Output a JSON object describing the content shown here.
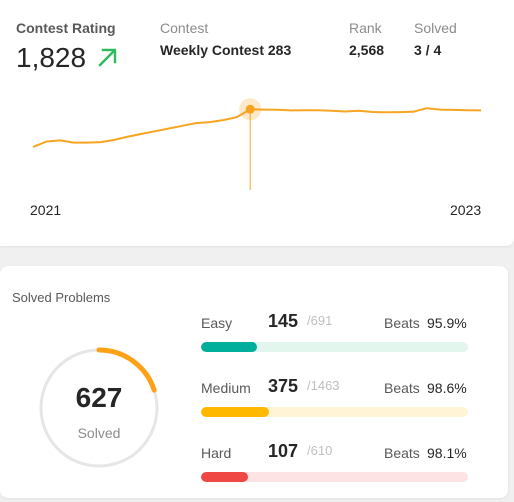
{
  "rating": {
    "title": "Contest Rating",
    "value": "1,828",
    "contest_label": "Contest",
    "contest_name": "Weekly Contest 283",
    "rank_label": "Rank",
    "rank_value": "2,568",
    "solved_label": "Solved",
    "solved_value": "3 / 4",
    "trend_icon": "arrow-up-right-icon",
    "trend_color": "#2cbb5d",
    "line_color": "#f7a521"
  },
  "chart_data": {
    "type": "line",
    "x_tick_labels": [
      "2021",
      "2023"
    ],
    "series": [
      {
        "values": [
          1480,
          1530,
          1540,
          1520,
          1520,
          1525,
          1545,
          1575,
          1600,
          1625,
          1650,
          1675,
          1700,
          1710,
          1728,
          1755,
          1828,
          1825,
          1823,
          1818,
          1820,
          1819,
          1815,
          1808,
          1814,
          1803,
          1800,
          1802,
          1805,
          1838,
          1825,
          1822,
          1820,
          1818
        ]
      }
    ],
    "highlight_index": 16
  },
  "solved": {
    "title": "Solved Problems",
    "total": "627",
    "total_label": "Solved",
    "progress": 0.0,
    "ring_progress": 0.2,
    "ring_color": "#ffa116",
    "ring_track_color": "#e6e6e6",
    "beats_label": "Beats",
    "difficulties": [
      {
        "name": "Easy",
        "solved": "145",
        "total": "/691",
        "beats": "95.9%",
        "fraction": 0.21,
        "color": "#00af9b",
        "track": "#e3f6ee"
      },
      {
        "name": "Medium",
        "solved": "375",
        "total": "/1463",
        "beats": "98.6%",
        "fraction": 0.256,
        "color": "#ffb800",
        "track": "#fff4d6"
      },
      {
        "name": "Hard",
        "solved": "107",
        "total": "/610",
        "beats": "98.1%",
        "fraction": 0.175,
        "color": "#ef4743",
        "track": "#fde3e3"
      }
    ]
  }
}
